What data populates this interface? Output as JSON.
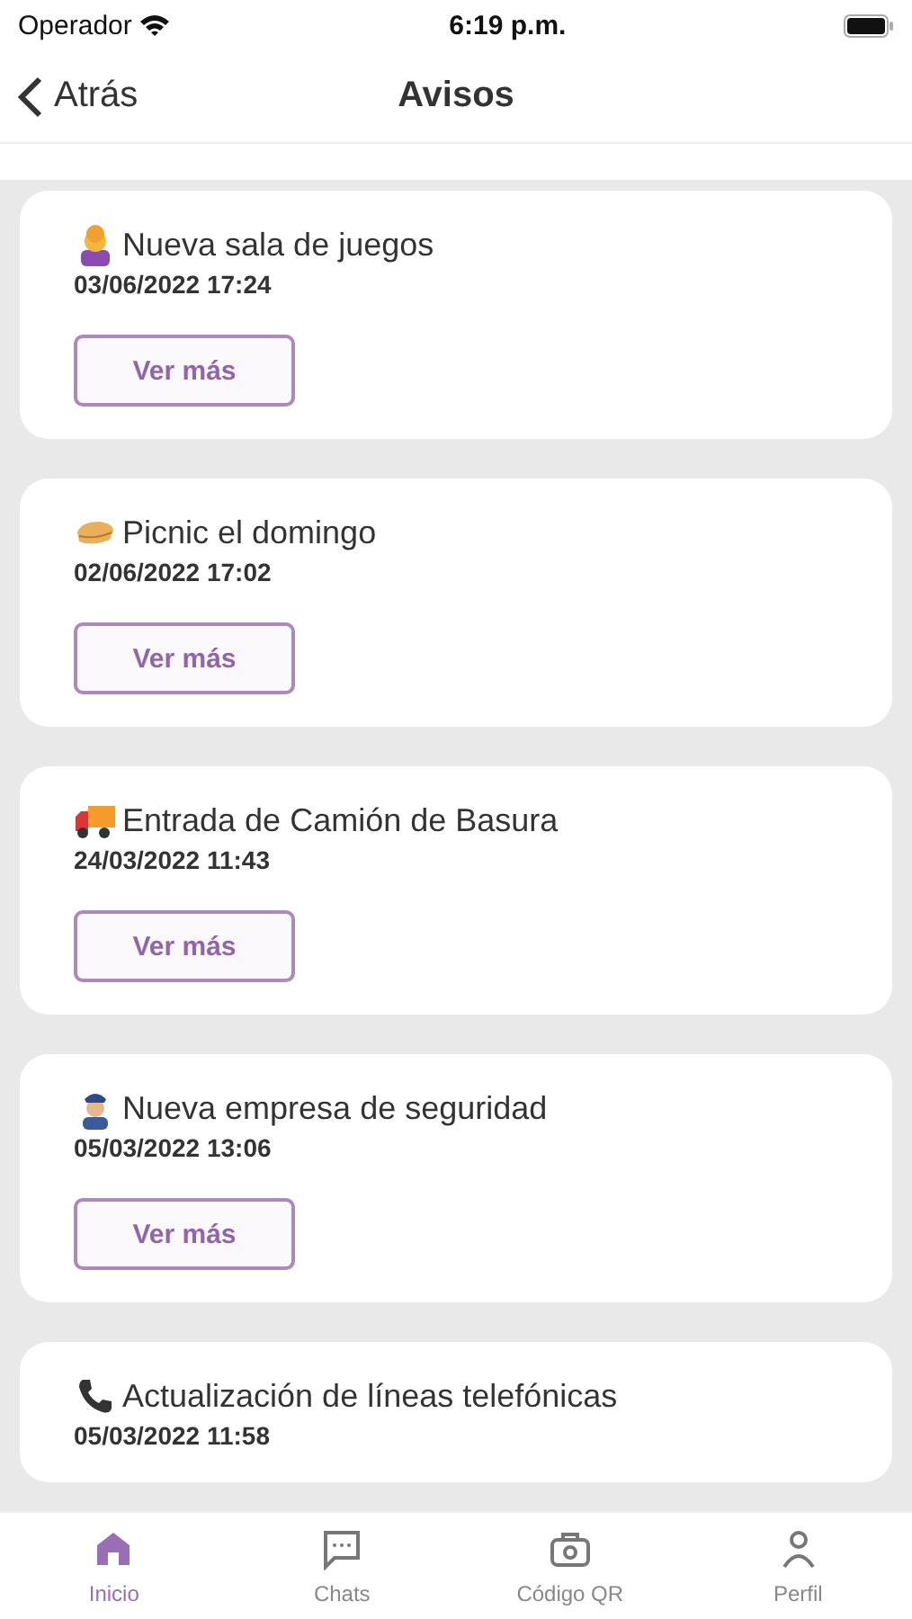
{
  "status_bar": {
    "carrier": "Operador",
    "time": "6:19 p.m."
  },
  "nav_bar": {
    "back": "Atrás",
    "title": "Avisos"
  },
  "notices": [
    {
      "title": "Nueva sala de juegos",
      "date": "03/06/2022 17:24",
      "button": "Ver más"
    },
    {
      "title": "Picnic el domingo",
      "date": "02/06/2022 17:02",
      "button": "Ver más"
    },
    {
      "title": "Entrada de Camión de Basura",
      "date": "24/03/2022 11:43",
      "button": "Ver más"
    },
    {
      "title": "Nueva empresa de seguridad",
      "date": "05/03/2022 13:06",
      "button": "Ver más"
    },
    {
      "title": "Actualización de líneas telefónicas",
      "date": "05/03/2022 11:58"
    }
  ],
  "tab_bar": [
    {
      "label": "Inicio",
      "selected": true
    },
    {
      "label": "Chats",
      "selected": false
    },
    {
      "label": "Código QR",
      "selected": false
    },
    {
      "label": "Perfil",
      "selected": false
    }
  ]
}
